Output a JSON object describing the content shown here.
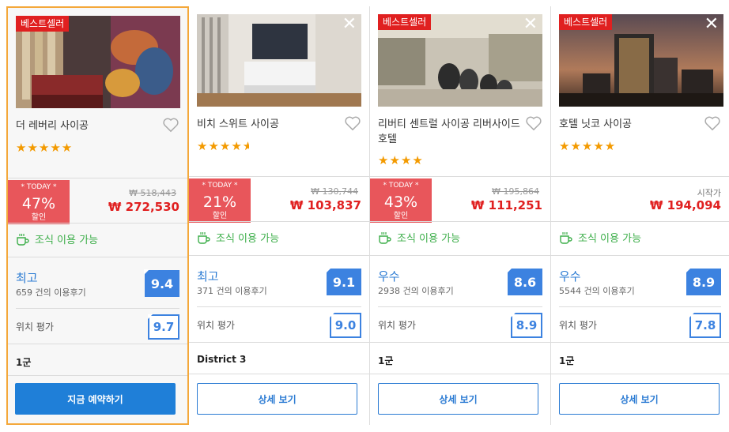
{
  "hotels": [
    {
      "tag": "베스트셀러",
      "name": "더 레버리 사이공",
      "stars": "★★★★★",
      "today": "* TODAY *",
      "discount": "47%",
      "discount_label": "할인",
      "old_price": "₩ 518,443",
      "price": "₩ 272,530",
      "breakfast": "조식 이용 가능",
      "rating_label": "최고",
      "reviews": "659 건의 이용후기",
      "rating": "9.4",
      "location_label": "위치 평가",
      "location_rating": "9.7",
      "district": "1군",
      "button": "지금 예약하기"
    },
    {
      "name": "비치 스위트 사이공",
      "stars": "★★★★",
      "half_star": "★",
      "today": "* TODAY *",
      "discount": "21%",
      "discount_label": "할인",
      "old_price": "₩ 130,744",
      "price": "₩ 103,837",
      "breakfast": "조식 이용 가능",
      "rating_label": "최고",
      "reviews": "371 건의 이용후기",
      "rating": "9.1",
      "location_label": "위치 평가",
      "location_rating": "9.0",
      "district": "District 3",
      "button": "상세 보기"
    },
    {
      "tag": "베스트셀러",
      "name": "리버티 센트럴 사이공 리버사이드 호텔",
      "stars": "★★★★",
      "today": "* TODAY *",
      "discount": "43%",
      "discount_label": "할인",
      "old_price": "₩ 195,864",
      "price": "₩ 111,251",
      "breakfast": "조식 이용 가능",
      "rating_label": "우수",
      "reviews": "2938 건의 이용후기",
      "rating": "8.6",
      "location_label": "위치 평가",
      "location_rating": "8.9",
      "district": "1군",
      "button": "상세 보기"
    },
    {
      "tag": "베스트셀러",
      "name": "호텔 닛코 사이공",
      "stars": "★★★★★",
      "from_label": "시작가",
      "price": "₩ 194,094",
      "breakfast": "조식 이용 가능",
      "rating_label": "우수",
      "reviews": "5544 건의 이용후기",
      "rating": "8.9",
      "location_label": "위치 평가",
      "location_rating": "7.8",
      "district": "1군",
      "button": "상세 보기"
    }
  ],
  "icons": {
    "close": "close-icon",
    "heart": "heart-icon",
    "breakfast": "coffee-cup-icon"
  },
  "colors": {
    "selected_border": "#f4a83a",
    "tag_red": "#e02020",
    "today_red": "#e8565b",
    "price_red": "#e02020",
    "breakfast_green": "#3cae49",
    "rating_blue": "#3c82e0",
    "button_blue": "#1f7fd8",
    "star_orange": "#f39a00"
  }
}
